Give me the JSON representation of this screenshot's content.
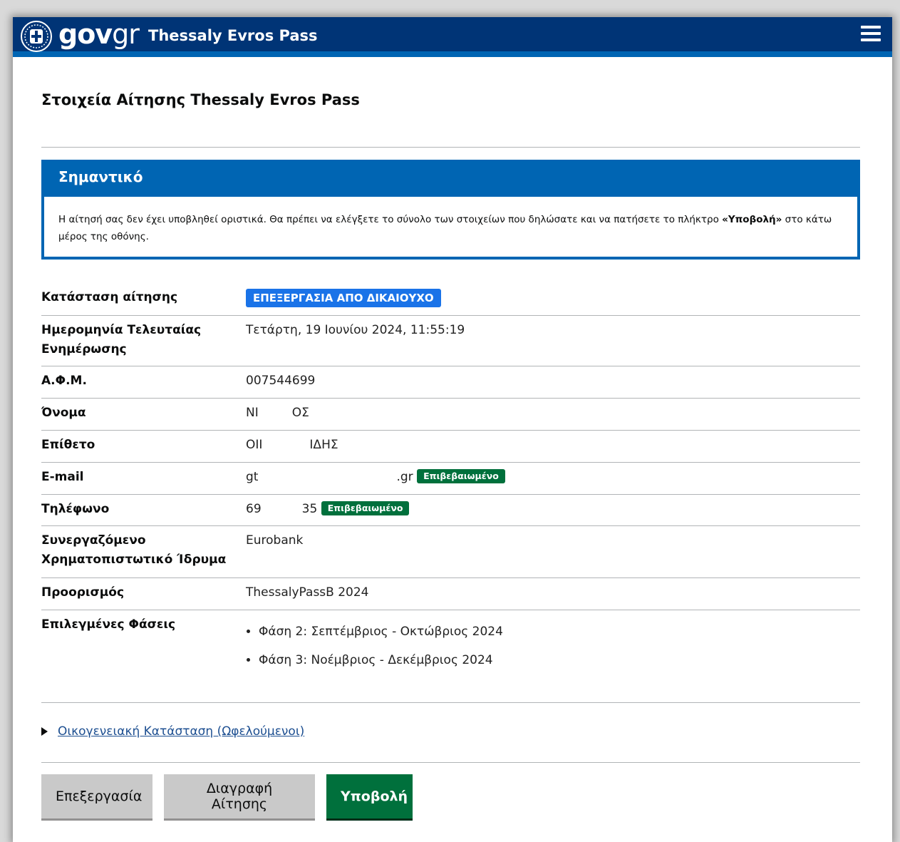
{
  "header": {
    "brand_gov": "gov",
    "brand_gr": "gr",
    "app_title": "Thessaly Evros Pass",
    "menu_icon": "hamburger-menu-icon",
    "emblem_icon": "greek-emblem-icon"
  },
  "page": {
    "title": "Στοιχεία Αίτησης Thessaly Evros Pass"
  },
  "notice": {
    "heading": "Σημαντικό",
    "text_before": "Η αίτησή σας δεν έχει υποβληθεί οριστικά. Θα πρέπει να ελέγξετε το σύνολο των στοιχείων που δηλώσατε και να πατήσετε το πλήκτρο ",
    "text_bold": "«Υποβολή»",
    "text_after": " στο κάτω μέρος της οθόνης."
  },
  "summary": {
    "status_label": "Κατάσταση αίτησης",
    "status_value": "ΕΠΕΞΕΡΓΑΣΙΑ ΑΠΟ ΔΙΚΑΙΟΥΧΟ",
    "updated_label": "Ημερομηνία Τελευταίας Ενημέρωσης",
    "updated_value": "Τετάρτη, 19 Ιουνίου 2024, 11:55:19",
    "afm_label": "Α.Φ.Μ.",
    "afm_value": "007544699",
    "name_label": "Όνομα",
    "name_value_a": "ΝΙ",
    "name_value_b": "ΟΣ",
    "surname_label": "Επίθετο",
    "surname_value_a": "ΟΙΙ",
    "surname_value_b": "ΙΔΗΣ",
    "email_label": "E-mail",
    "email_value_a": "gt",
    "email_value_b": ".gr",
    "email_badge": "Επιβεβαιωμένο",
    "phone_label": "Τηλέφωνο",
    "phone_value_a": "69",
    "phone_value_b": "35",
    "phone_badge": "Επιβεβαιωμένο",
    "bank_label": "Συνεργαζόμενο Χρηματοπιστωτικό Ίδρυμα",
    "bank_value": "Eurobank",
    "destination_label": "Προορισμός",
    "destination_value": "ThessalyPassB 2024",
    "phases_label": "Επιλεγμένες Φάσεις",
    "phases": [
      "Φάση 2: Σεπτέμβριος - Οκτώβριος 2024",
      "Φάση 3: Νοέμβριος - Δεκέμβριος 2024"
    ]
  },
  "family": {
    "link_label": "Οικογενειακή Κατάσταση (Ωφελούμενοι)"
  },
  "actions": {
    "edit": "Επεξεργασία",
    "delete": "Διαγραφή Αίτησης",
    "submit": "Υποβολή"
  },
  "colors": {
    "header_bg": "#003476",
    "accent_blue": "#0065b3",
    "status_badge": "#1a73e8",
    "verified_badge": "#00703c",
    "submit_button": "#00703c"
  }
}
